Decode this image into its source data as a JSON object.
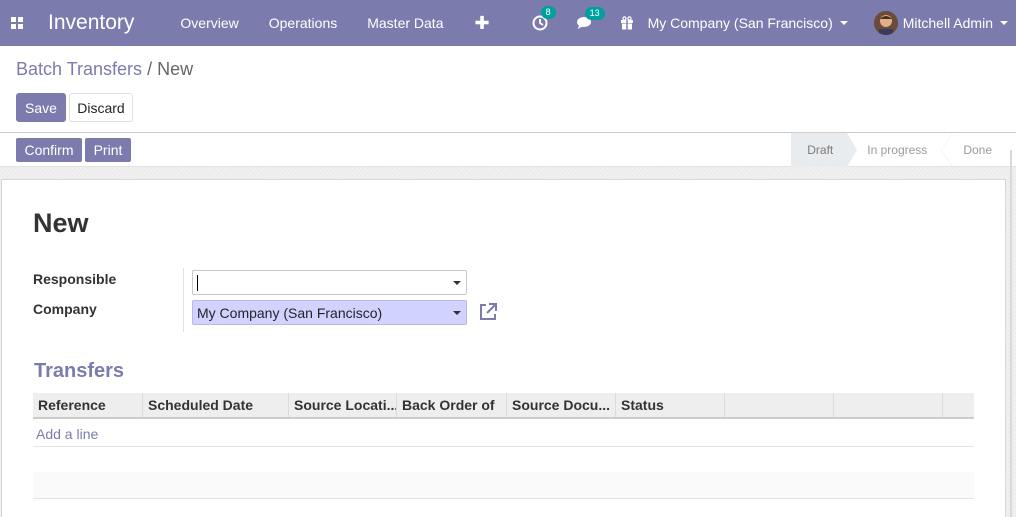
{
  "navbar": {
    "app_name": "Inventory",
    "menu": [
      "Overview",
      "Operations",
      "Master Data"
    ],
    "activity_count": "8",
    "messages_count": "13",
    "company": "My Company (San Francisco)",
    "user": "Mitchell Admin"
  },
  "breadcrumb": {
    "parent": "Batch Transfers",
    "separator": "/",
    "current": "New"
  },
  "buttons": {
    "save": "Save",
    "discard": "Discard",
    "confirm": "Confirm",
    "print": "Print"
  },
  "stages": [
    "Draft",
    "In progress",
    "Done"
  ],
  "form": {
    "title": "New",
    "responsible_label": "Responsible",
    "responsible_value": "",
    "company_label": "Company",
    "company_value": "My Company (San Francisco)"
  },
  "transfers": {
    "title": "Transfers",
    "columns": [
      "Reference",
      "Scheduled Date",
      "Source Locati...",
      "Back Order of",
      "Source Docu...",
      "Status",
      "",
      "",
      ""
    ],
    "add_line": "Add a line"
  },
  "colors": {
    "brand": "#7c7bad",
    "badge": "#00a09d"
  }
}
